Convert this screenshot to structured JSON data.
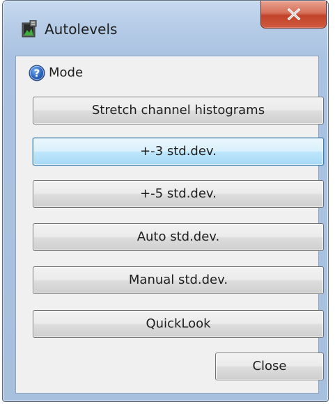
{
  "window": {
    "title": "Autolevels",
    "close_glyph": "X"
  },
  "mode": {
    "label": "Mode",
    "icon": "help-icon"
  },
  "buttons": {
    "stretch": "Stretch channel histograms",
    "std3": "+-3 std.dev.",
    "std5": "+-5 std.dev.",
    "auto": "Auto std.dev.",
    "manual": "Manual std.dev.",
    "quicklook": "QuickLook",
    "close": "Close"
  },
  "focused_button": "+-3 std.dev.",
  "colors": {
    "close_button_red": "#c2432a",
    "focus_blue": "#3c7fb1",
    "frame_blue": "#aac3e2"
  }
}
